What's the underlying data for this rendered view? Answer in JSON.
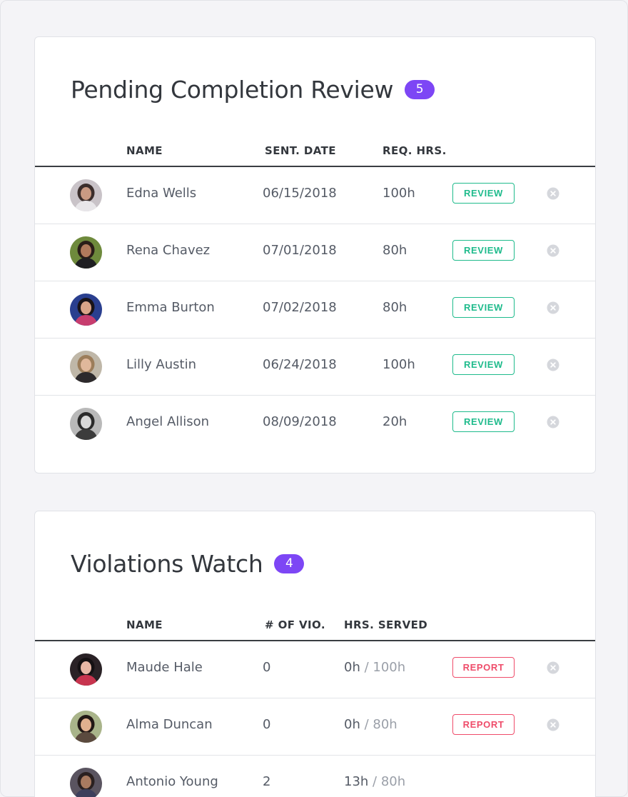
{
  "pending": {
    "title": "Pending Completion Review",
    "count": "5",
    "headers": {
      "name": "NAME",
      "date": "SENT. DATE",
      "hours": "REQ. HRS."
    },
    "rows": [
      {
        "name": "Edna Wells",
        "date": "06/15/2018",
        "hours": "100h",
        "action": "REVIEW",
        "avatar": {
          "bg": "#c9c3c8",
          "hair": "#3b2e2c",
          "skin": "#c99a83",
          "shirt": "#e8e6e9"
        }
      },
      {
        "name": "Rena Chavez",
        "date": "07/01/2018",
        "hours": "80h",
        "action": "REVIEW",
        "avatar": {
          "bg": "#6e8a3c",
          "hair": "#2a1e18",
          "skin": "#b07a5c",
          "shirt": "#1f1f22"
        }
      },
      {
        "name": "Emma Burton",
        "date": "07/02/2018",
        "hours": "80h",
        "action": "REVIEW",
        "avatar": {
          "bg": "#2a3f8f",
          "hair": "#1a1418",
          "skin": "#d9a488",
          "shirt": "#c73d6e"
        }
      },
      {
        "name": "Lilly Austin",
        "date": "06/24/2018",
        "hours": "100h",
        "action": "REVIEW",
        "avatar": {
          "bg": "#bfb7a8",
          "hair": "#9c7d5a",
          "skin": "#e0b89b",
          "shirt": "#2d2a2c"
        }
      },
      {
        "name": "Angel Allison",
        "date": "08/09/2018",
        "hours": "20h",
        "action": "REVIEW",
        "avatar": {
          "bg": "#b9b9b9",
          "hair": "#2b2b2b",
          "skin": "#d8d8d8",
          "shirt": "#3c3c3c"
        }
      }
    ]
  },
  "violations": {
    "title": "Violations Watch",
    "count": "4",
    "headers": {
      "name": "NAME",
      "violations": "# OF VIO.",
      "served": "HRS. SERVED"
    },
    "rows": [
      {
        "name": "Maude Hale",
        "violations": "0",
        "served": "0h",
        "required": "/ 100h",
        "action": "REPORT",
        "avatar": {
          "bg": "#2a2226",
          "hair": "#151113",
          "skin": "#e7b7a5",
          "shirt": "#c7344e"
        }
      },
      {
        "name": "Alma Duncan",
        "violations": "0",
        "served": "0h",
        "required": "/ 80h",
        "action": "REPORT",
        "avatar": {
          "bg": "#a9b48a",
          "hair": "#221816",
          "skin": "#e0b08f",
          "shirt": "#5b4a3e"
        }
      },
      {
        "name": "Antonio Young",
        "violations": "2",
        "served": "13h",
        "required": "/ 80h",
        "action": "",
        "avatar": {
          "bg": "#5a5460",
          "hair": "#2a2020",
          "skin": "#a87a60",
          "shirt": "#3d3f5c"
        }
      }
    ]
  },
  "colors": {
    "accent_badge": "#7d46f5",
    "review_green": "#1fbb8c",
    "report_red": "#ef4c6a"
  },
  "icons": {
    "close": "close-circle-icon"
  }
}
